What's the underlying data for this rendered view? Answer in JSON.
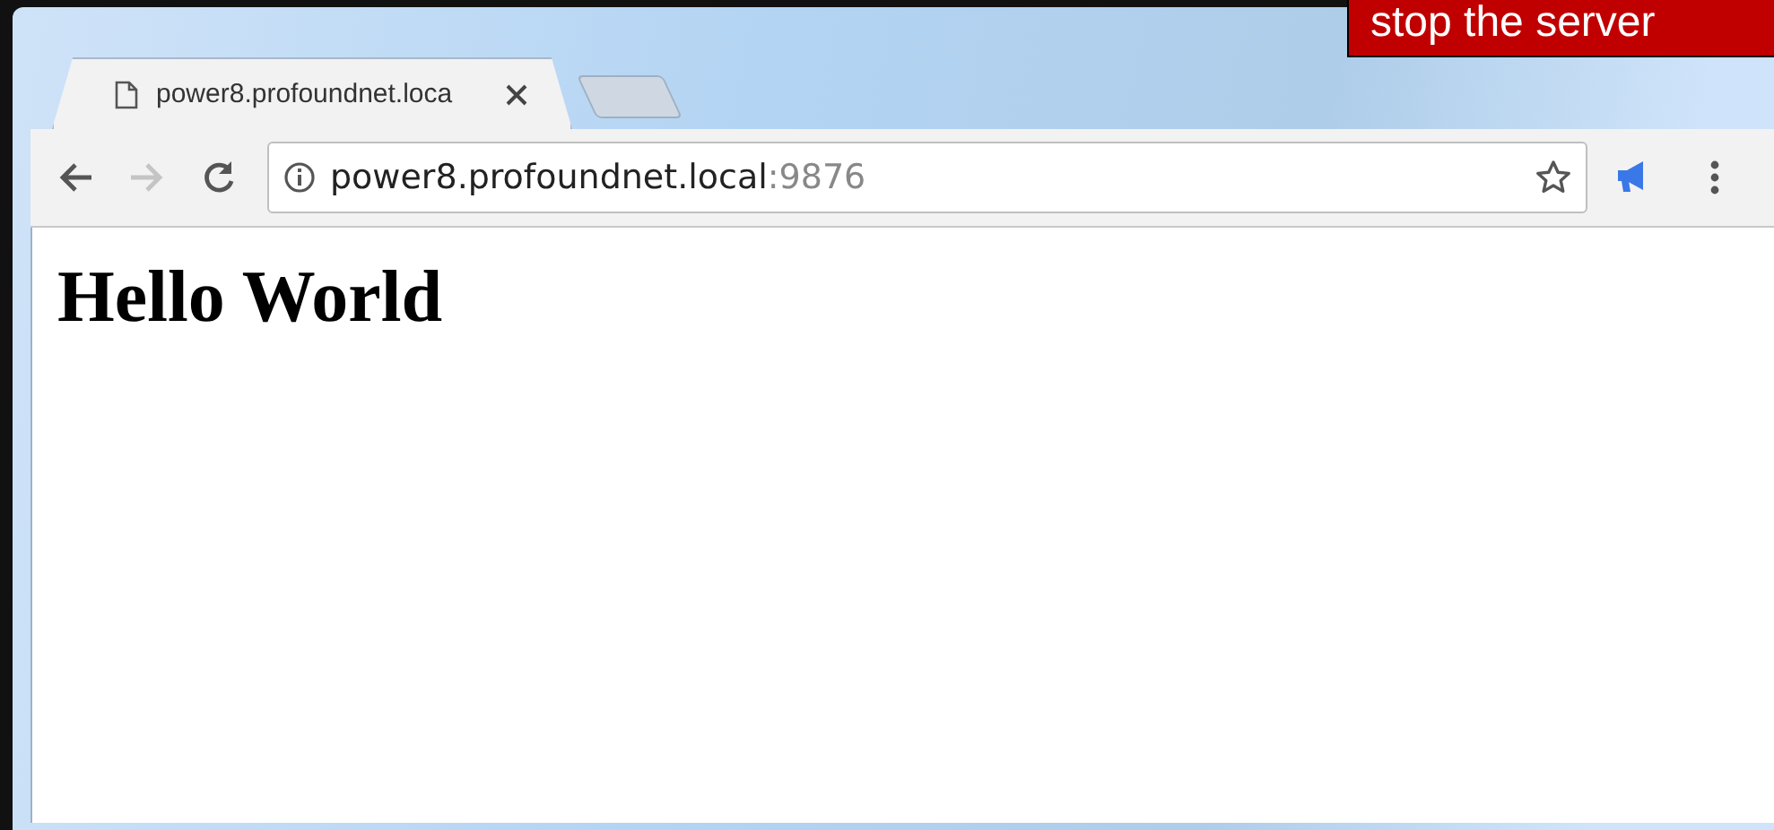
{
  "overlay_label": "stop the server",
  "tabs": [
    {
      "title": "power8.profoundnet.loca",
      "selected": true
    }
  ],
  "address_bar": {
    "host": "power8.profoundnet.local",
    "port": ":9876"
  },
  "navigation": {
    "back_disabled": false,
    "forward_disabled": true
  },
  "page": {
    "heading": "Hello World"
  }
}
